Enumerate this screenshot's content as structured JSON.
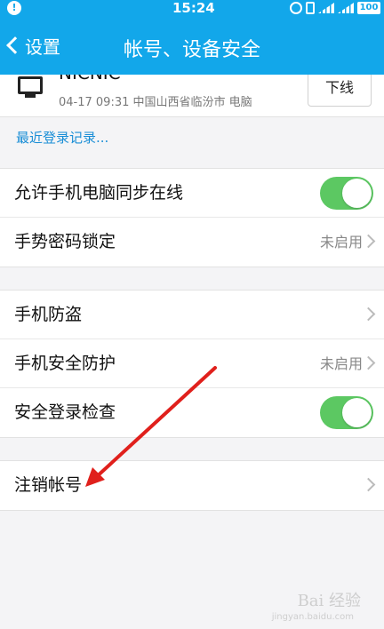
{
  "status_bar": {
    "time": "15:24",
    "notification_glyph": "!",
    "battery": "100",
    "icons": [
      "alarm-icon",
      "vibrate-icon",
      "signal-icon",
      "signal-icon",
      "battery-icon"
    ]
  },
  "nav": {
    "back_label": "设置",
    "title": "帐号、设备安全"
  },
  "device": {
    "name": "NICNIC",
    "meta": "04-17 09:31 中国山西省临汾市 电脑",
    "logout_label": "下线"
  },
  "recent_login_link": "最近登录记录...",
  "group1": {
    "sync_online": {
      "label": "允许手机电脑同步在线",
      "enabled": true
    },
    "gesture_lock": {
      "label": "手势密码锁定",
      "value": "未启用"
    }
  },
  "group2": {
    "anti_theft": {
      "label": "手机防盗"
    },
    "phone_protection": {
      "label": "手机安全防护",
      "value": "未启用"
    },
    "login_check": {
      "label": "安全登录检查",
      "enabled": true
    }
  },
  "group3": {
    "cancel_account": {
      "label": "注销帐号"
    }
  },
  "colors": {
    "accent": "#12a7ea",
    "toggle_on": "#5cc862",
    "link": "#1a8ed6",
    "annotation_arrow": "#e0201c"
  },
  "watermark": {
    "text": "Bai 经验",
    "sub": "jingyan.baidu.com"
  }
}
